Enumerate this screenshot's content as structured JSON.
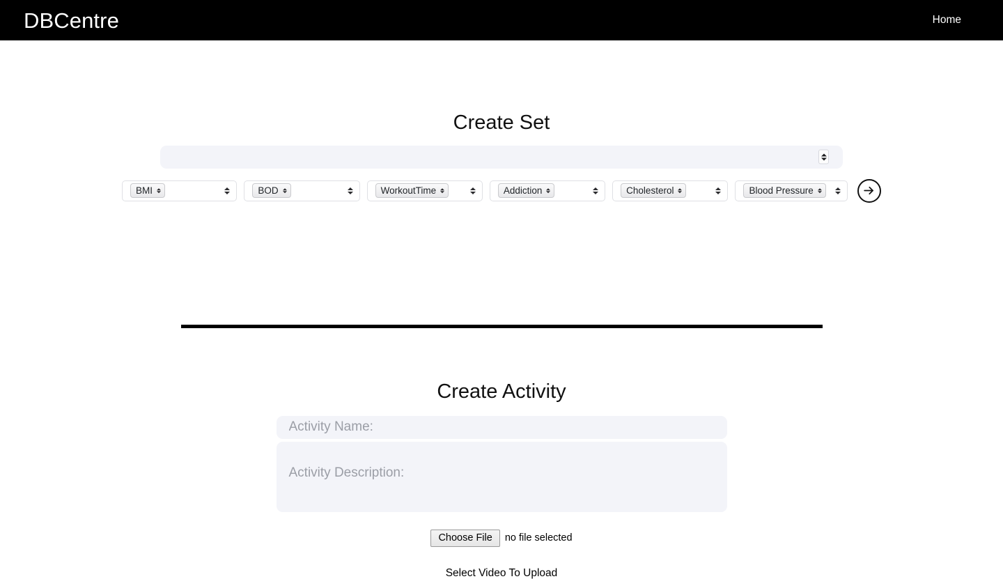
{
  "navbar": {
    "brand": "DBCentre",
    "links": [
      {
        "label": "Home",
        "name": "nav-link-home"
      }
    ]
  },
  "create_set": {
    "title": "Create Set",
    "number_input": {
      "value": "",
      "placeholder": ""
    },
    "selects": [
      {
        "outer_value": "",
        "inner_value": "BMI"
      },
      {
        "outer_value": "",
        "inner_value": "BOD"
      },
      {
        "outer_value": "",
        "inner_value": "WorkoutTime"
      },
      {
        "outer_value": "",
        "inner_value": "Addiction"
      },
      {
        "outer_value": "",
        "inner_value": "Cholesterol"
      },
      {
        "outer_value": "",
        "inner_value": "Blood Pressure"
      }
    ],
    "submit_icon": "arrow-right-circle-icon"
  },
  "create_activity": {
    "title": "Create Activity",
    "name_input": {
      "value": "",
      "placeholder": "Activity Name:"
    },
    "description_input": {
      "value": "",
      "placeholder": "Activity Description:"
    },
    "file_picker": {
      "button_label": "Choose File",
      "status": "no file selected"
    },
    "upload_label": "Select Video To Upload"
  },
  "colors": {
    "navbar_bg": "#000000",
    "navbar_text": "#ffffff",
    "page_bg": "#ffffff",
    "field_bg": "#f3f4f9",
    "placeholder": "#9b9ea6",
    "divider": "#000000"
  }
}
